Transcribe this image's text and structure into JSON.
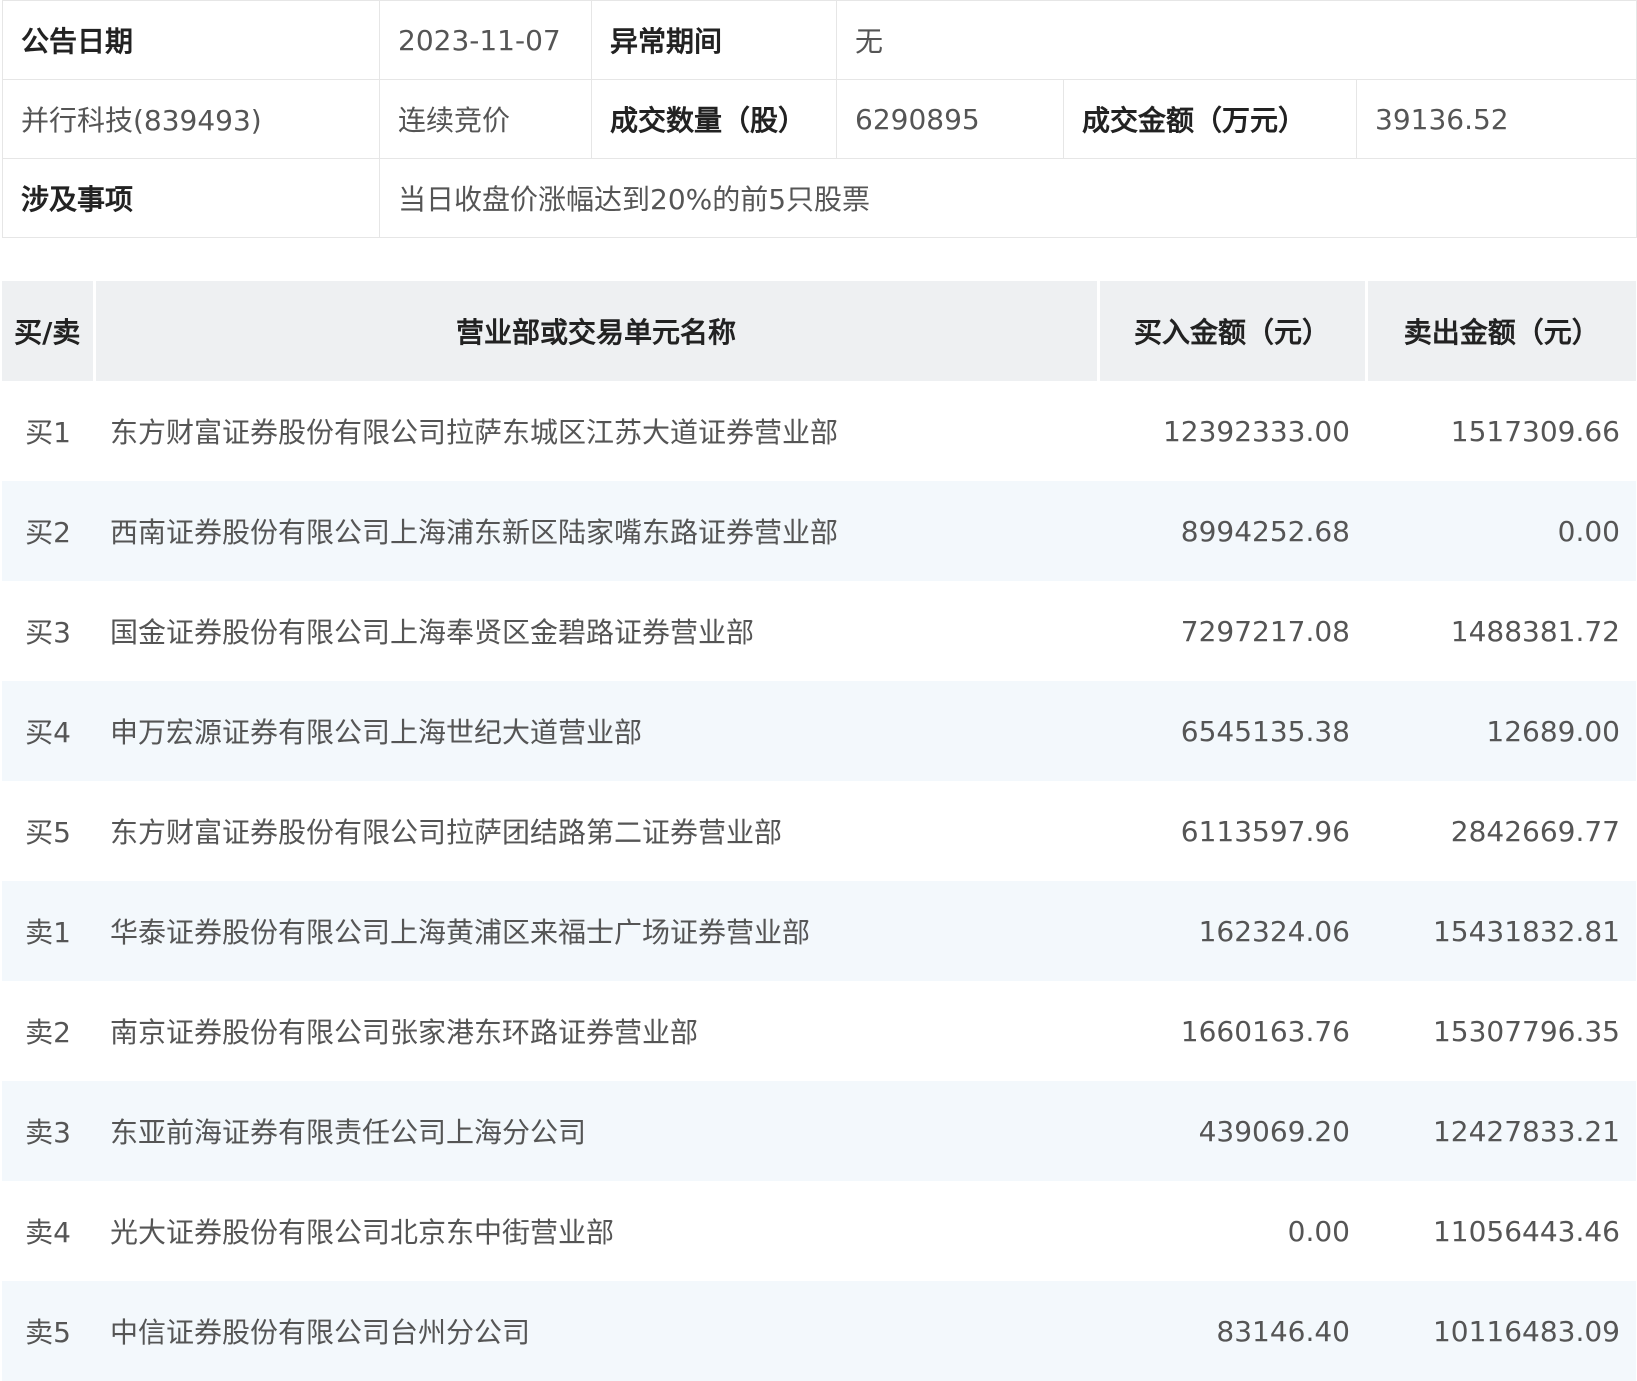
{
  "info": {
    "announce_date_label": "公告日期",
    "announce_date_value": "2023-11-07",
    "abnormal_period_label": "异常期间",
    "abnormal_period_value": "无",
    "stock_name": "并行科技(839493)",
    "trade_type": "连续竞价",
    "volume_label": "成交数量（股）",
    "volume_value": "6290895",
    "amount_label": "成交金额（万元）",
    "amount_value": "39136.52",
    "matter_label": "涉及事项",
    "matter_value": "当日收盘价涨幅达到20%的前5只股票"
  },
  "trades": {
    "headers": {
      "side": "买/卖",
      "name": "营业部或交易单元名称",
      "buy": "买入金额（元）",
      "sell": "卖出金额（元）"
    },
    "rows": [
      {
        "side": "买1",
        "name": "东方财富证券股份有限公司拉萨东城区江苏大道证券营业部",
        "buy": "12392333.00",
        "sell": "1517309.66"
      },
      {
        "side": "买2",
        "name": "西南证券股份有限公司上海浦东新区陆家嘴东路证券营业部",
        "buy": "8994252.68",
        "sell": "0.00"
      },
      {
        "side": "买3",
        "name": "国金证券股份有限公司上海奉贤区金碧路证券营业部",
        "buy": "7297217.08",
        "sell": "1488381.72"
      },
      {
        "side": "买4",
        "name": "申万宏源证券有限公司上海世纪大道营业部",
        "buy": "6545135.38",
        "sell": "12689.00"
      },
      {
        "side": "买5",
        "name": "东方财富证券股份有限公司拉萨团结路第二证券营业部",
        "buy": "6113597.96",
        "sell": "2842669.77"
      },
      {
        "side": "卖1",
        "name": "华泰证券股份有限公司上海黄浦区来福士广场证券营业部",
        "buy": "162324.06",
        "sell": "15431832.81"
      },
      {
        "side": "卖2",
        "name": "南京证券股份有限公司张家港东环路证券营业部",
        "buy": "1660163.76",
        "sell": "15307796.35"
      },
      {
        "side": "卖3",
        "name": "东亚前海证券有限责任公司上海分公司",
        "buy": "439069.20",
        "sell": "12427833.21"
      },
      {
        "side": "卖4",
        "name": "光大证券股份有限公司北京东中街营业部",
        "buy": "0.00",
        "sell": "11056443.46"
      },
      {
        "side": "卖5",
        "name": "中信证券股份有限公司台州分公司",
        "buy": "83146.40",
        "sell": "10116483.09"
      }
    ]
  }
}
